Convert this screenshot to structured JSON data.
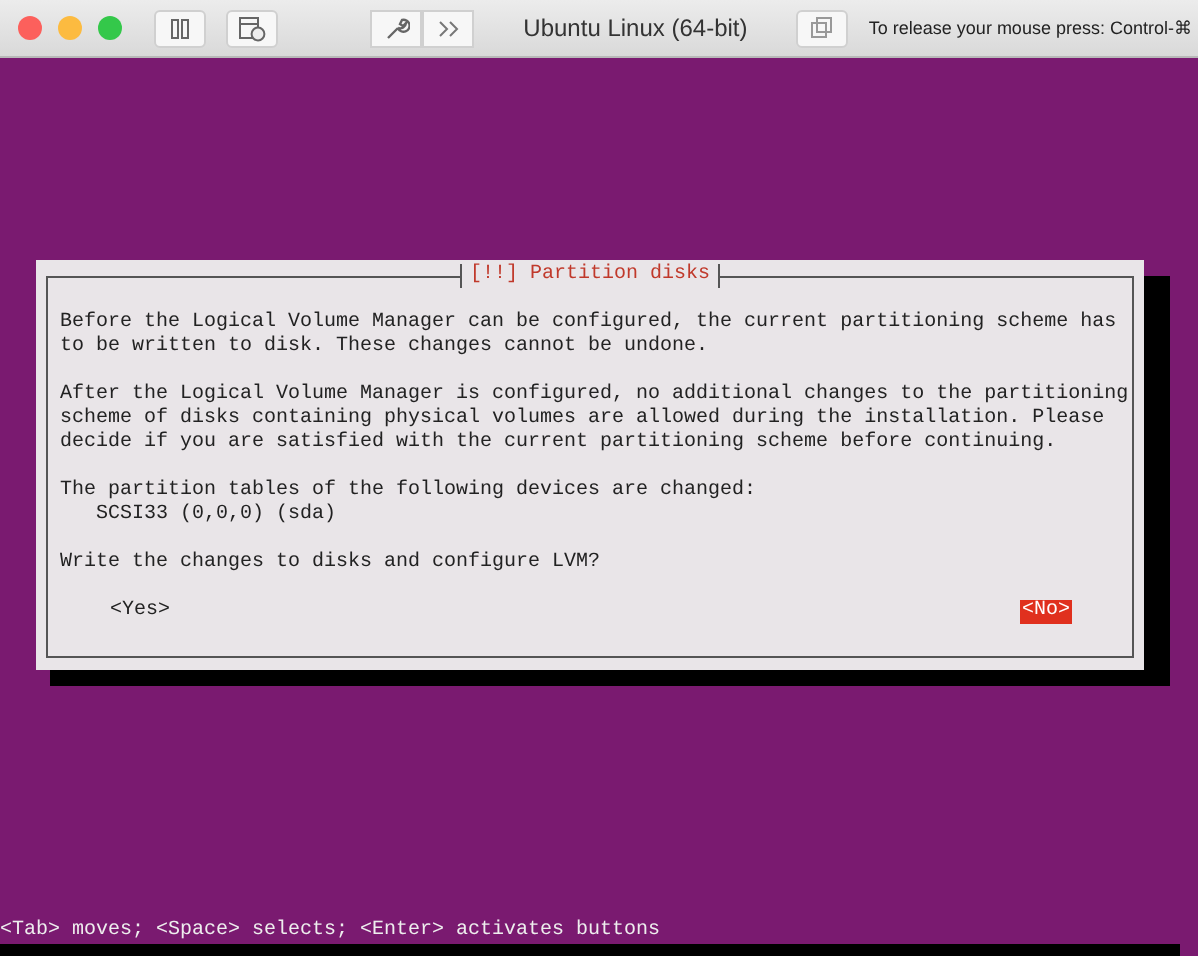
{
  "window": {
    "title": "Ubuntu Linux (64-bit)",
    "release_hint": "To release your mouse press: Control-⌘"
  },
  "dialog": {
    "title": "[!!] Partition disks",
    "paragraphs": [
      "Before the Logical Volume Manager can be configured, the current partitioning scheme has\nto be written to disk. These changes cannot be undone.",
      "After the Logical Volume Manager is configured, no additional changes to the partitioning\nscheme of disks containing physical volumes are allowed during the installation. Please\ndecide if you are satisfied with the current partitioning scheme before continuing.",
      "The partition tables of the following devices are changed:\n   SCSI33 (0,0,0) (sda)",
      "Write the changes to disks and configure LVM?"
    ],
    "buttons": [
      {
        "label": "<Yes>",
        "selected": false
      },
      {
        "label": "<No>",
        "selected": true
      }
    ]
  },
  "status_bar": "<Tab> moves; <Space> selects; <Enter> activates buttons"
}
